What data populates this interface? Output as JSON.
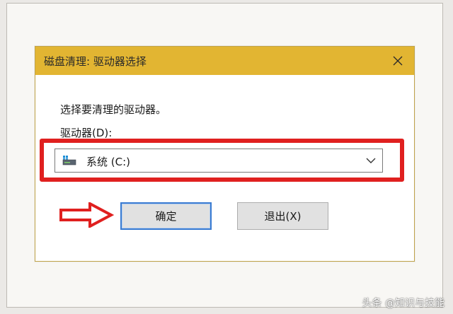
{
  "dialog": {
    "title": "磁盘清理: 驱动器选择",
    "close_icon": "close-icon",
    "prompt": "选择要清理的驱动器。",
    "drive_label": "驱动器(D):",
    "drive_select": {
      "value": "系统 (C:)",
      "icon": "hard-drive-icon"
    },
    "buttons": {
      "ok_label": "确定",
      "exit_label": "退出(X)"
    }
  },
  "annotation": {
    "highlight_color": "#e0201f",
    "arrow_color": "#e0201f"
  },
  "watermark": "头条 @知识与技能",
  "colors": {
    "titlebar": "#e2b532",
    "ok_focus_border": "#3a7bd1"
  }
}
